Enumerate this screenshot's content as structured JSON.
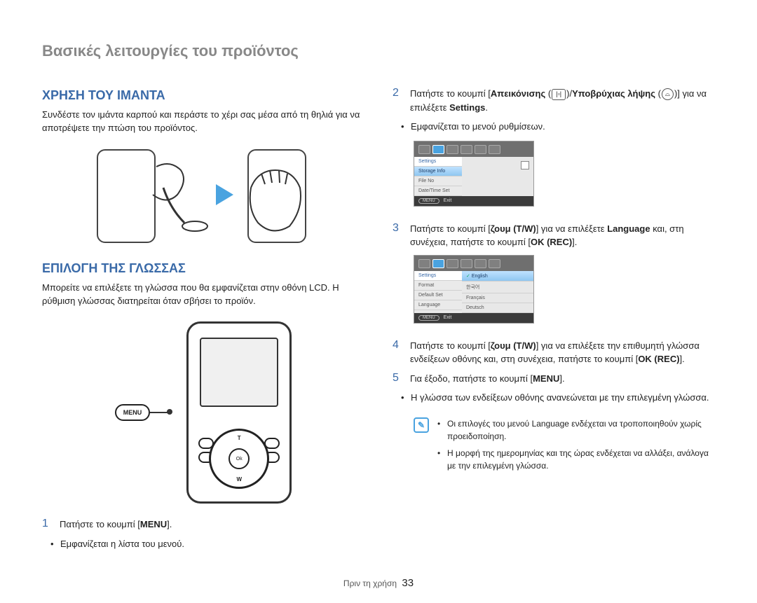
{
  "page_title": "Βασικές λειτουργίες του προϊόντος",
  "left": {
    "section1": {
      "heading": "ΧΡΗΣΗ ΤΟΥ ΙΜΑΝΤΑ",
      "body": "Συνδέστε τον ιμάντα καρπού και περάστε το χέρι σας μέσα από τη θηλιά για να αποτρέψετε την πτώση του προϊόντος."
    },
    "section2": {
      "heading": "ΕΠΙΛΟΓΗ ΤΗΣ ΓΛΩΣΣΑΣ",
      "body": "Μπορείτε να επιλέξετε τη γλώσσα που θα εμφανίζεται στην οθόνη LCD. Η ρύθμιση γλώσσας διατηρείται όταν σβήσει το προϊόν."
    },
    "menu_pill": "MENU",
    "dpad": {
      "top": "T",
      "bottom": "W",
      "center": "Ok"
    },
    "step1": {
      "num": "1",
      "text_a": "Πατήστε το κουμπί [",
      "text_menu": "MENU",
      "text_b": "].",
      "bullet": "Εμφανίζεται η λίστα του μενού."
    }
  },
  "right": {
    "step2": {
      "num": "2",
      "t1": "Πατήστε το κουμπί [",
      "t2": "Απεικόνισης",
      "t3": " (",
      "t4": ")/",
      "t5": "Υποβρύχιας λήψης",
      "t6": " (",
      "t7": ")] για να επιλέξετε ",
      "t8": "Settings",
      "t9": ".",
      "bullet": "Εμφανίζεται το μενού ρυθμίσεων."
    },
    "shot1": {
      "header": "Settings",
      "items": [
        "Storage Info",
        "File No",
        "Date/Time Set"
      ],
      "selected_index": 0,
      "footer_btn": "MENU",
      "footer_label": "Exit"
    },
    "step3": {
      "num": "3",
      "t1": "Πατήστε το κουμπί [",
      "t2": "ζουμ (T/W)",
      "t3": "] για να επιλέξετε ",
      "t4": "Language",
      "t5": " και, στη συνέχεια, πατήστε το κουμπί [",
      "t6": "OK (REC)",
      "t7": "]."
    },
    "shot2": {
      "header": "Settings",
      "left_items": [
        "Format",
        "Default Set",
        "Language"
      ],
      "right_items": [
        "English",
        "한국어",
        "Français",
        "Deutsch"
      ],
      "selected_right": 0,
      "footer_btn": "MENU",
      "footer_label": "Exit"
    },
    "step4": {
      "num": "4",
      "t1": "Πατήστε το κουμπί [",
      "t2": "ζουμ (T/W)",
      "t3": "] για να επιλέξετε την επιθυμητή γλώσσα ενδείξεων οθόνης και, στη συνέχεια, πατήστε το κουμπί [",
      "t4": "OK (REC)",
      "t5": "]."
    },
    "step5": {
      "num": "5",
      "t1": "Για έξοδο, πατήστε το κουμπί [",
      "t2": "MENU",
      "t3": "].",
      "bullet": "Η γλώσσα των ενδείξεων οθόνης ανανεώνεται με την επιλεγμένη γλώσσα."
    },
    "note": {
      "items": [
        {
          "a": "Οι επιλογές του μενού ",
          "b": "Language",
          "c": " ενδέχεται να τροποποιηθούν χωρίς προειδοποίηση."
        },
        {
          "a": "Η μορφή της ημερομηνίας και της ώρας ενδέχεται να αλλάξει, ανάλογα με την επιλεγμένη γλώσσα.",
          "b": "",
          "c": ""
        }
      ]
    }
  },
  "footer": {
    "section": "Πριν τη χρήση",
    "page": "33"
  },
  "icons": {
    "display": "▢",
    "underwater": "◎",
    "check": "✓"
  }
}
